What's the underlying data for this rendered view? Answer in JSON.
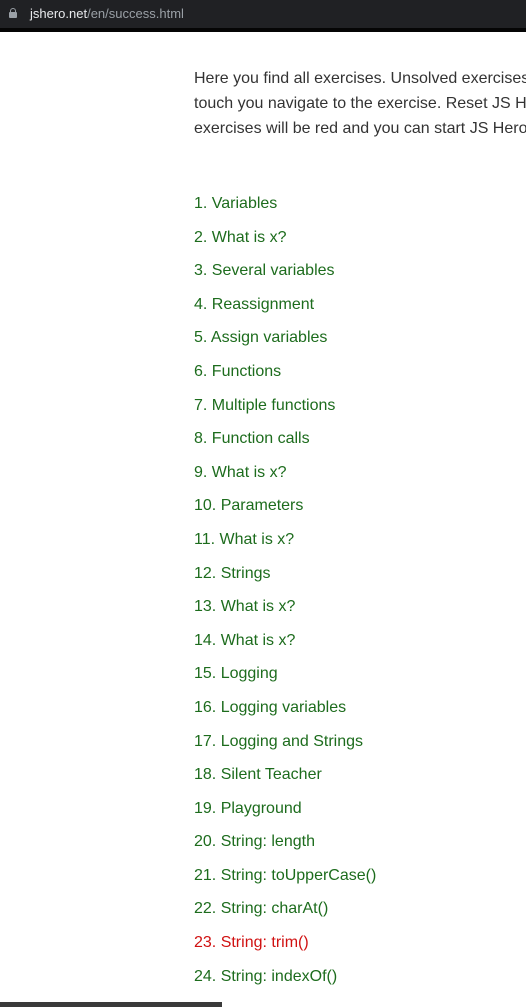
{
  "browser": {
    "url_host": "jshero.net",
    "url_path": "/en/success.html"
  },
  "intro": {
    "lines": [
      "Here you find all exercises. Unsolved exercises",
      "touch you navigate to the exercise. Reset JS H",
      "exercises will be red and you can start JS Hero"
    ]
  },
  "exercises": [
    {
      "label": "1. Variables",
      "solved": true
    },
    {
      "label": "2. What is x?",
      "solved": true
    },
    {
      "label": "3. Several variables",
      "solved": true
    },
    {
      "label": "4. Reassignment",
      "solved": true
    },
    {
      "label": "5. Assign variables",
      "solved": true
    },
    {
      "label": "6. Functions",
      "solved": true
    },
    {
      "label": "7. Multiple functions",
      "solved": true
    },
    {
      "label": "8. Function calls",
      "solved": true
    },
    {
      "label": "9. What is x?",
      "solved": true
    },
    {
      "label": "10. Parameters",
      "solved": true
    },
    {
      "label": "11. What is x?",
      "solved": true
    },
    {
      "label": "12. Strings",
      "solved": true
    },
    {
      "label": "13. What is x?",
      "solved": true
    },
    {
      "label": "14. What is x?",
      "solved": true
    },
    {
      "label": "15. Logging",
      "solved": true
    },
    {
      "label": "16. Logging variables",
      "solved": true
    },
    {
      "label": "17. Logging and Strings",
      "solved": true
    },
    {
      "label": "18. Silent Teacher",
      "solved": true
    },
    {
      "label": "19. Playground",
      "solved": true
    },
    {
      "label": "20. String: length",
      "solved": true
    },
    {
      "label": "21. String: toUpperCase()",
      "solved": true
    },
    {
      "label": "22. String: charAt()",
      "solved": true
    },
    {
      "label": "23. String: trim()",
      "solved": false
    },
    {
      "label": "24. String: indexOf()",
      "solved": true
    }
  ],
  "colors": {
    "solved": "#1d6c1d",
    "unsolved": "#d01111"
  }
}
